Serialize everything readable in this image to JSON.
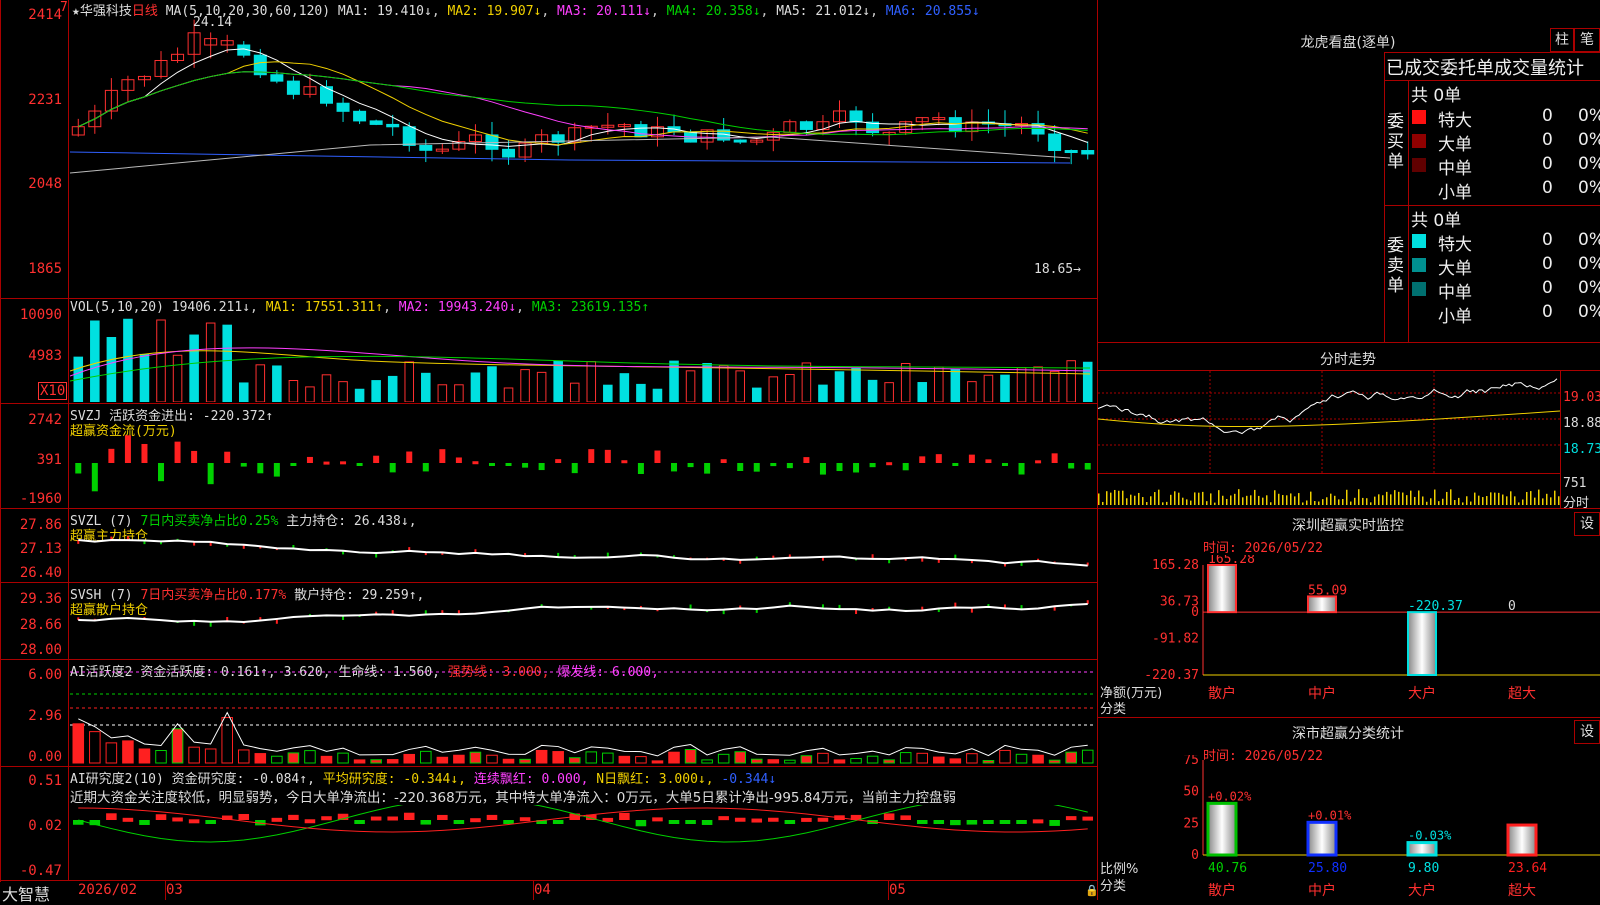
{
  "stock": {
    "star": "★",
    "name": "华强科技",
    "period": "日线"
  },
  "kline": {
    "ma_header": "MA(5,10,20,30,60,120)",
    "ma1": "MA1: 19.410↓",
    "ma2": "MA2: 19.907↓",
    "ma3": "MA3: 20.111↓",
    "ma4": "MA4: 20.358↓",
    "ma5": "MA5: 21.012↓",
    "ma6": "MA6: 20.855↓",
    "high_mark": "24.14",
    "low_mark": "18.65→",
    "yticks": [
      "2414",
      "2231",
      "2048",
      "1865"
    ],
    "mark7": "7"
  },
  "vol": {
    "header": "VOL(5,10,20)",
    "val": "19406.211↓",
    "ma1": "MA1: 17551.311↑",
    "ma2": "MA2: 19943.240↓",
    "ma3": "MA3: 23619.135↑",
    "yticks": [
      "10090",
      "4983"
    ],
    "unit": "X10"
  },
  "svzj": {
    "header": "SVZJ  活跃资金进出: -220.372↑",
    "sub": "超赢资金流(万元)",
    "yticks": [
      "2742",
      "391",
      "-1960"
    ]
  },
  "svzl": {
    "header": "SVZL (7)",
    "p1": "7日内买卖净占比0.25%",
    "p2": "主力持仓: 26.438↓,",
    "sub": "超赢主力持仓",
    "yticks": [
      "27.86",
      "27.13",
      "26.40"
    ]
  },
  "svsh": {
    "header": "SVSH (7)",
    "p1": "7日内买卖净占比0.177%",
    "p2": "散户持仓: 29.259↑,",
    "sub": "超赢散户持仓",
    "yticks": [
      "29.36",
      "28.66",
      "28.00"
    ]
  },
  "ai1": {
    "header": "AI活跃度2",
    "p1": "资金活跃度: 0.161↑,",
    "p2": "3.620,",
    "p3": "生命线: 1.560,",
    "p4": "强势线: 3.000,",
    "p5": "爆发线: 6.000,",
    "yticks": [
      "6.00",
      "2.96",
      "0.00"
    ]
  },
  "ai2": {
    "header": "AI研究度2(10)",
    "p1": "资金研究度: -0.084↑,",
    "p2": "平均研究度: -0.344↓,",
    "p3": "连续飘红: 0.000,",
    "p4": "N日飘红: 3.000↓,",
    "p5": "-0.344↓",
    "comment": "近期大资金关注度较低，明显弱势，今日大单净流出：-220.368万元，其中特大单净流入：0万元，大单5日累计净出-995.84万元，当前主力控盘弱",
    "yticks": [
      "0.51",
      "0.02",
      "-0.47"
    ]
  },
  "xaxis": {
    "labels": [
      "2026/02",
      "03",
      "04",
      "05"
    ],
    "brand": "大智慧"
  },
  "lhb": {
    "title": "龙虎看盘(逐单)",
    "btn1": "柱",
    "btn2": "笔",
    "heading": "已成交委托单成交量统计",
    "buy_label": "委买单",
    "sell_label": "委卖单",
    "buy_total": "共 0单",
    "sell_total": "共 0单",
    "buy_rows": [
      {
        "label": "特大",
        "v": "0",
        "p": "0%",
        "color": "#ff1010"
      },
      {
        "label": "大单",
        "v": "0",
        "p": "0%",
        "color": "#900000"
      },
      {
        "label": "中单",
        "v": "0",
        "p": "0%",
        "color": "#600000"
      },
      {
        "label": "小单",
        "v": "0",
        "p": "0%",
        "color": "#000000"
      }
    ],
    "sell_rows": [
      {
        "label": "特大",
        "v": "0",
        "p": "0%",
        "color": "#00e0e0"
      },
      {
        "label": "大单",
        "v": "0",
        "p": "0%",
        "color": "#009090"
      },
      {
        "label": "中单",
        "v": "0",
        "p": "0%",
        "color": "#007070"
      },
      {
        "label": "小单",
        "v": "0",
        "p": "0%",
        "color": "#000000"
      }
    ]
  },
  "fenshi": {
    "title": "分时走势",
    "yticks": [
      "19.03",
      "18.88",
      "18.73"
    ],
    "vol_tick": "751",
    "vol_label": "分时"
  },
  "monitor": {
    "title": "深圳超赢实时监控",
    "btn": "设",
    "time": "时间: 2026/05/22",
    "yticks": [
      "165.28",
      "36.73",
      "0",
      "-91.82",
      "-220.37"
    ],
    "ylabel": "净额(万元)",
    "xlabel": "分类",
    "bars": [
      {
        "cat": "散户",
        "value": 165.28,
        "label": "165.28"
      },
      {
        "cat": "中户",
        "value": 55.09,
        "label": "55.09"
      },
      {
        "cat": "大户",
        "value": -220.37,
        "label": "-220.37"
      },
      {
        "cat": "超大",
        "value": 0,
        "label": "0"
      }
    ]
  },
  "classify": {
    "title": "深市超赢分类统计",
    "btn": "设",
    "time": "时间: 2026/05/22",
    "yticks": [
      "75",
      "50",
      "25",
      "0"
    ],
    "ylabel": "比例%",
    "xlabel": "分类",
    "bars": [
      {
        "cat": "散户",
        "value": 40.76,
        "chg": "+0.02%",
        "label": "40.76",
        "color": "#00c000"
      },
      {
        "cat": "中户",
        "value": 25.8,
        "chg": "+0.01%",
        "label": "25.80",
        "color": "#1030ff"
      },
      {
        "cat": "大户",
        "value": 9.8,
        "chg": "-0.03%",
        "label": "9.80",
        "color": "#00e0e0"
      },
      {
        "cat": "超大",
        "value": 23.64,
        "chg": "",
        "label": "23.64",
        "color": "#ff2020"
      }
    ]
  },
  "chart_data": [
    {
      "type": "bar",
      "categories": [
        "散户",
        "中户",
        "大户",
        "超大"
      ],
      "values": [
        165.28,
        55.09,
        -220.37,
        0
      ],
      "ylim": [
        -220.37,
        165.28
      ]
    },
    {
      "type": "bar",
      "categories": [
        "散户",
        "中户",
        "大户",
        "超大"
      ],
      "values": [
        40.76,
        25.8,
        9.8,
        23.64
      ],
      "ylim": [
        0,
        75
      ]
    }
  ]
}
